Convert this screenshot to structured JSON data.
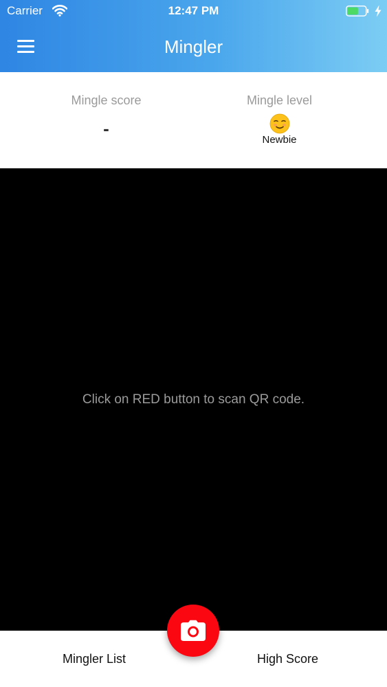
{
  "status_bar": {
    "carrier": "Carrier",
    "time": "12:47 PM",
    "battery_level_fraction": 0.6,
    "battery_color": "#4cd964"
  },
  "header": {
    "title": "Mingler",
    "menu_icon": "hamburger-menu-icon",
    "gradient_colors": [
      "#2f86e3",
      "#7ccdf4"
    ]
  },
  "stats": {
    "score_label": "Mingle score",
    "score_value": "-",
    "level_label": "Mingle level",
    "level_emoji_icon": "smiling-face-emoji-icon",
    "level_name": "Newbie"
  },
  "camera": {
    "hint": "Click on RED button to scan QR code."
  },
  "bottom_bar": {
    "left_tab": "Mingler List",
    "right_tab": "High Score",
    "scan_button_icon": "camera-icon",
    "scan_button_color": "#fa0712"
  }
}
